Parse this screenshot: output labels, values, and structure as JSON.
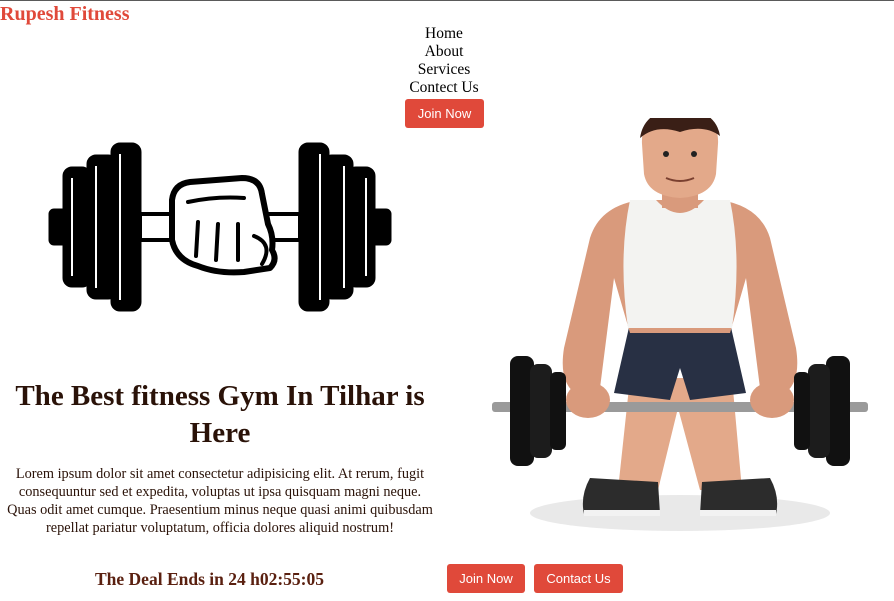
{
  "brand": {
    "name": "Rupesh Fitness"
  },
  "nav": {
    "items": [
      {
        "label": "Home"
      },
      {
        "label": "About"
      },
      {
        "label": "Services"
      },
      {
        "label": "Contect Us"
      }
    ],
    "join_label": "Join Now"
  },
  "hero": {
    "title": "The Best fitness Gym In Tilhar is Here",
    "text": "Lorem ipsum dolor sit amet consectetur adipisicing elit. At rerum, fugit consequuntur sed et expedita, voluptas ut ipsa quisquam magni neque. Quas odit amet cumque. Praesentium minus neque quasi animi quibusdam repellat pariatur voluptatum, officia dolores aliquid nostrum!",
    "deal_text": "The Deal Ends in 24 h02:55:05",
    "join_label": "Join Now",
    "contact_label": "Contact Us"
  },
  "images": {
    "logo_icon": "dumbbell-fist-icon",
    "hero_icon": "cartoon-bodybuilder-illustration"
  },
  "colors": {
    "accent": "#e0493a",
    "heading": "#2a1208",
    "deal": "#5a2010"
  }
}
